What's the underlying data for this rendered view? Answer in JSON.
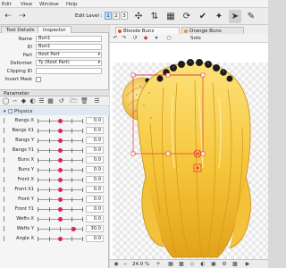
{
  "menu": [
    "Edit",
    "View",
    "Window",
    "Help"
  ],
  "toolbar": {
    "edit_level_label": "Edit Level :",
    "levels": [
      "1",
      "2",
      "3"
    ]
  },
  "left_panel": {
    "tabs": [
      "Tool Details",
      "Inspector"
    ],
    "active_tab": "Inspector",
    "properties": [
      {
        "label": "Name",
        "value": "Bun1"
      },
      {
        "label": "ID",
        "value": "Bun1"
      },
      {
        "label": "Part",
        "value": "Root Part"
      },
      {
        "label": "Deformer",
        "value": "Ty (Root Part)"
      },
      {
        "label": "Clipping ID",
        "value": ""
      },
      {
        "label": "Invert Mask",
        "value": ""
      }
    ],
    "parameter_header": "Parameter",
    "group_name": "Physics",
    "parameters": [
      {
        "name": "Bangs X",
        "value": "0.0",
        "pos": 0.5
      },
      {
        "name": "Bangs X1",
        "value": "0.0",
        "pos": 0.5
      },
      {
        "name": "Bangs Y",
        "value": "0.0",
        "pos": 0.5
      },
      {
        "name": "Bangs Y1",
        "value": "0.0",
        "pos": 0.5
      },
      {
        "name": "Buns X",
        "value": "0.0",
        "pos": 0.5
      },
      {
        "name": "Buns Y",
        "value": "0.0",
        "pos": 0.5
      },
      {
        "name": "Front X",
        "value": "0.0",
        "pos": 0.5
      },
      {
        "name": "Front X1",
        "value": "0.0",
        "pos": 0.5
      },
      {
        "name": "Front Y",
        "value": "0.0",
        "pos": 0.5
      },
      {
        "name": "Front Y1",
        "value": "0.0",
        "pos": 0.5
      },
      {
        "name": "Wefts X",
        "value": "0.0",
        "pos": 0.5
      },
      {
        "name": "Wefts Y",
        "value": "30.0",
        "pos": 0.8
      },
      {
        "name": "Angle X",
        "value": "0.0",
        "pos": 0.5
      }
    ]
  },
  "viewer": {
    "tabs": [
      {
        "label": "Blonde Buns",
        "dot_color": "#e24a2a"
      },
      {
        "label": "Orange Buns",
        "dot_color": "#e8953a"
      }
    ],
    "solo_label": "Solo",
    "zoom": "24.0",
    "zoom_unit": "%"
  },
  "colors": {
    "accent": "#e0245e",
    "hair_light": "#fde27a",
    "hair_mid": "#f4c63c",
    "hair_dark": "#c98a10",
    "ribbon": "#1c1c1c",
    "selection": "#e53935"
  }
}
